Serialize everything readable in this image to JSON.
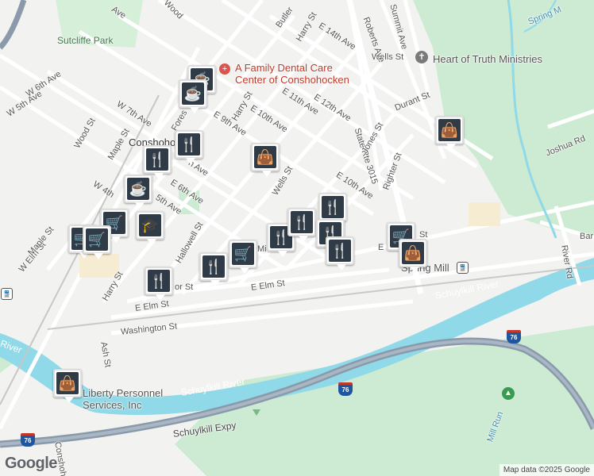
{
  "map": {
    "credit": "Map data ©2025 Google",
    "logo": "Google",
    "colors": {
      "land": "#f2f2f0",
      "green": "#cdebd2",
      "water": "#8fd9e8",
      "highway": "#8a9aab",
      "road": "#ffffff",
      "pin": "#2f3b46"
    }
  },
  "labels": {
    "sutcliffe_park": "Sutcliffe Park",
    "conshohocken": "Conshohocken",
    "dental": "A Family Dental Care\nCenter of Conshohocken",
    "heart_truth": "Heart of Truth Ministries",
    "liberty": "Liberty Personnel\nServices, Inc",
    "spring_mill": "Spring Mill",
    "schuylkill_river_1": "Schuylkill River",
    "schuylkill_river_2": "Schuylkill River",
    "river_partial": "River",
    "schuylkill_expy": "Schuylkill Expy",
    "state_rte": "State Rte 3015",
    "i76_a": "76",
    "i76_b": "76",
    "i76_c": "76",
    "w_elm": "W Elm St",
    "e_elm_1": "E Elm St",
    "e_elm_2": "E Elm St",
    "washington": "Washington St",
    "harry_1": "Harry St",
    "harry_2": "Harry St",
    "harry_3": "Harry St",
    "maple_1": "Maple St",
    "maple_2": "Maple St",
    "wood_1": "Wood St",
    "fores": "Fores",
    "w_6th": "W 6th Ave",
    "w_5th": "W 5th Ave",
    "w_7th": "W 7th Ave",
    "w_4th": "W 4th",
    "e_6th": "E 6th Ave",
    "e_5th": "5th Ave",
    "e_9th": "E 9th Ave",
    "e_10th_1": "E 10th Ave",
    "e_10th_2": "E 10th Ave",
    "e_11th": "E 11th Ave",
    "e_12th": "E 12th Ave",
    "e_14th": "E 14th Ave",
    "hallowell": "Hallowell St",
    "wells_1": "Wells St",
    "wells_2": "Wells St",
    "jones": "Jones St",
    "righter": "Righter St",
    "durant": "Durant St",
    "roberts": "Roberts Ave",
    "summit": "Summit Ave",
    "butler": "Butler",
    "ash": "Ash St",
    "river_rd": "River Rd",
    "joshua": "Joshua Rd",
    "bar": "Bar",
    "spring_top": "Spring M",
    "mill_run": "Mill Run",
    "conshoh": "Conshoh",
    "ave_top": "Ave",
    "wood_top": "Wood",
    "mi": "Mi",
    "or_st": "or St",
    "e_label": "E",
    "st_label": "St",
    "h_ave": "h Ave",
    "e_10th_short": "10th"
  },
  "markers": [
    {
      "id": "coffee-1",
      "icon": "coffee-icon",
      "glyph": "☕"
    },
    {
      "id": "restaurant-1",
      "icon": "restaurant-icon",
      "glyph": "🍴"
    },
    {
      "id": "shopping-1",
      "icon": "shopping-bag-icon",
      "glyph": "👜"
    },
    {
      "id": "restaurant-2",
      "icon": "restaurant-icon",
      "glyph": "🍴"
    },
    {
      "id": "coffee-2",
      "icon": "coffee-icon",
      "glyph": "☕"
    },
    {
      "id": "school-1",
      "icon": "school-icon",
      "glyph": "🎓"
    },
    {
      "id": "grocery-1",
      "icon": "grocery-cart-icon",
      "glyph": "🛒"
    },
    {
      "id": "grocery-2",
      "icon": "grocery-cart-icon",
      "glyph": "🛒"
    },
    {
      "id": "grocery-3",
      "icon": "grocery-cart-icon",
      "glyph": "🛒"
    },
    {
      "id": "restaurant-3",
      "icon": "restaurant-icon",
      "glyph": "🍴"
    },
    {
      "id": "restaurant-4",
      "icon": "restaurant-icon",
      "glyph": "🍴"
    },
    {
      "id": "restaurant-5",
      "icon": "restaurant-icon",
      "glyph": "🍴"
    },
    {
      "id": "restaurant-6",
      "icon": "restaurant-icon",
      "glyph": "🍴"
    },
    {
      "id": "restaurant-7",
      "icon": "restaurant-icon",
      "glyph": "🍴"
    },
    {
      "id": "restaurant-8",
      "icon": "restaurant-icon",
      "glyph": "🍴"
    },
    {
      "id": "restaurant-9",
      "icon": "restaurant-icon",
      "glyph": "🍴"
    },
    {
      "id": "grocery-4",
      "icon": "grocery-cart-icon",
      "glyph": "🛒"
    },
    {
      "id": "shopping-2",
      "icon": "shopping-bag-icon",
      "glyph": "👜"
    },
    {
      "id": "shopping-3",
      "icon": "shopping-bag-icon",
      "glyph": "👜"
    },
    {
      "id": "shopping-4",
      "icon": "shopping-bag-icon",
      "glyph": "👜"
    }
  ]
}
